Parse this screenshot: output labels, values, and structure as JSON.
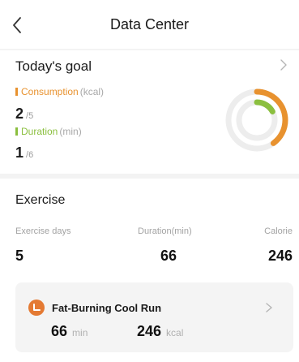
{
  "header": {
    "title": "Data Center"
  },
  "goal": {
    "title": "Today's goal",
    "consumption": {
      "label": "Consumption",
      "unit": "(kcal)",
      "value": "2",
      "target": "/5",
      "color": "#e8922f"
    },
    "duration": {
      "label": "Duration",
      "unit": "(min)",
      "value": "1",
      "target": "/6",
      "color": "#8bbf3f"
    },
    "ring": {
      "outer_progress": 0.4,
      "inner_progress": 0.17,
      "outer_color": "#e8922f",
      "inner_color": "#8bbf3f",
      "track_color": "#ededed"
    }
  },
  "exercise": {
    "title": "Exercise",
    "stats": [
      {
        "label": "Exercise days",
        "value": "5"
      },
      {
        "label": "Duration(min)",
        "value": "66"
      },
      {
        "label": "Calorie",
        "value": "246"
      }
    ],
    "activity": {
      "name": "Fat-Burning Cool Run",
      "icon": "running-icon",
      "icon_color": "#e47a33",
      "duration_value": "66",
      "duration_unit": "min",
      "calories_value": "246",
      "calories_unit": "kcal"
    }
  }
}
